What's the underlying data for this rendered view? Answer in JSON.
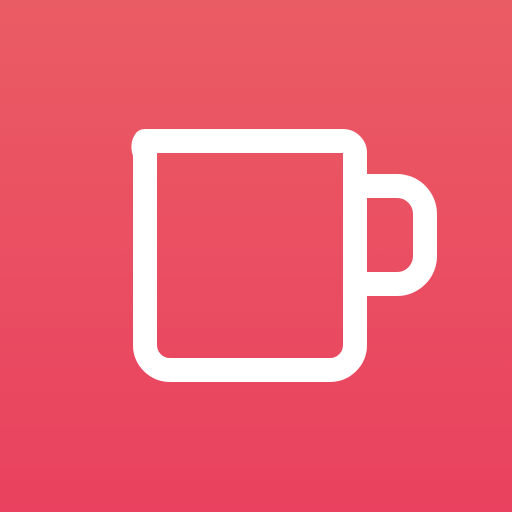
{
  "icon": {
    "name": "mug-icon",
    "background_top_color": "#EA5C64",
    "background_bottom_color": "#E9415F",
    "glyph_color": "#FFFFFF"
  }
}
